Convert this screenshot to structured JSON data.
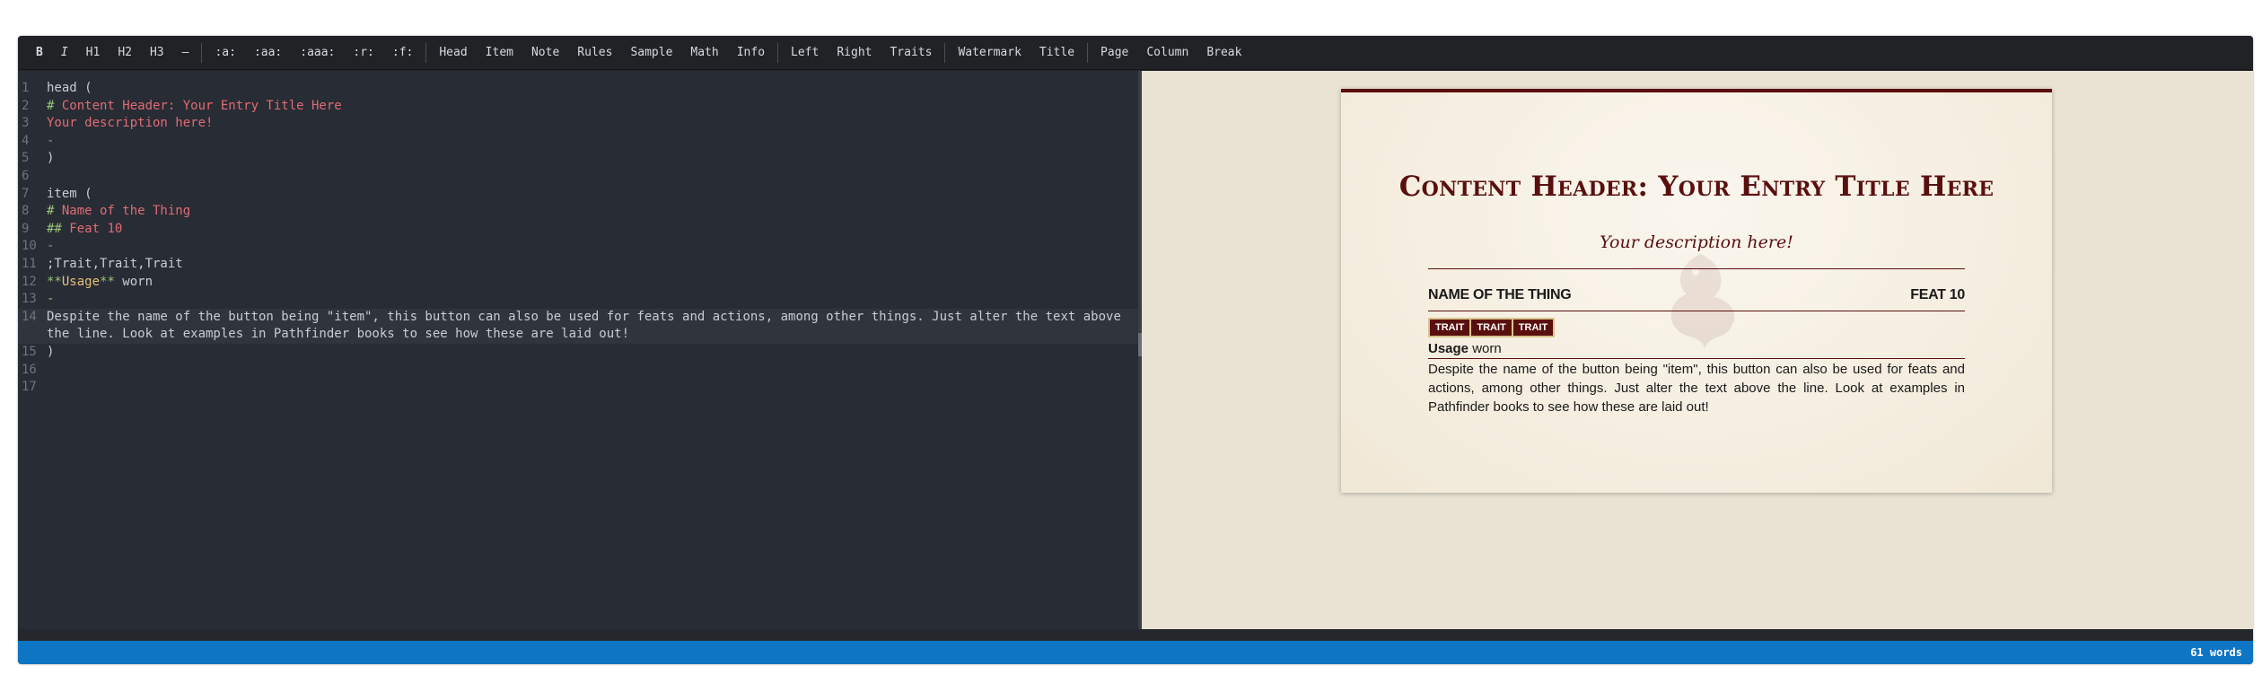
{
  "toolbar": {
    "groups": [
      [
        "B",
        "I",
        "H1",
        "H2",
        "H3",
        "—"
      ],
      [
        ":a:",
        ":aa:",
        ":aaa:",
        ":r:",
        ":f:"
      ],
      [
        "Head",
        "Item",
        "Note",
        "Rules",
        "Sample",
        "Math",
        "Info"
      ],
      [
        "Left",
        "Right",
        "Traits"
      ],
      [
        "Watermark",
        "Title"
      ],
      [
        "Page",
        "Column",
        "Break"
      ]
    ]
  },
  "editor": {
    "line_numbers": [
      "1",
      "2",
      "3",
      "4",
      "5",
      "6",
      "7",
      "8",
      "9",
      "10",
      "11",
      "12",
      "13",
      "14",
      "15",
      "16",
      "17"
    ],
    "lines": {
      "l1": "head (",
      "l2_hash": "# ",
      "l2_text": "Content Header: Your Entry Title Here",
      "l3": "Your description here!",
      "l4": "-",
      "l5": ")",
      "l7": "item (",
      "l8_hash": "# ",
      "l8_text": "Name of the Thing",
      "l9_hash": "## ",
      "l9_text": "Feat 10",
      "l10": "-",
      "l11": ";Trait,Trait,Trait",
      "l12_open": "**",
      "l12_strong": "Usage",
      "l12_close": "**",
      "l12_rest": " worn",
      "l13": "-",
      "l14": "Despite the name of the button being \"item\", this button can also be used for feats and actions, among other things. Just alter the text above the line. Look at examples in Pathfinder books to see how these are laid out!",
      "l15": ")"
    }
  },
  "preview": {
    "title": "Content Header: Your Entry Title Here",
    "description": "Your description here!",
    "item_name": "NAME OF THE THING",
    "item_level": "FEAT 10",
    "traits": [
      "TRAIT",
      "TRAIT",
      "TRAIT"
    ],
    "usage_label": "Usage",
    "usage_value": " worn",
    "body": "Despite the name of the button being \"item\", this button can also be used for feats and actions, among other things. Just alter the text above the line. Look at examples in Pathfinder books to see how these are laid out!",
    "watermark_icon": "dragon-watermark-icon"
  },
  "status": {
    "word_count": "61 words"
  },
  "colors": {
    "accent": "#0e74c4",
    "header_red": "#5a0f0f",
    "editor_bg": "#282c34",
    "page_bg": "#f5eee0"
  }
}
